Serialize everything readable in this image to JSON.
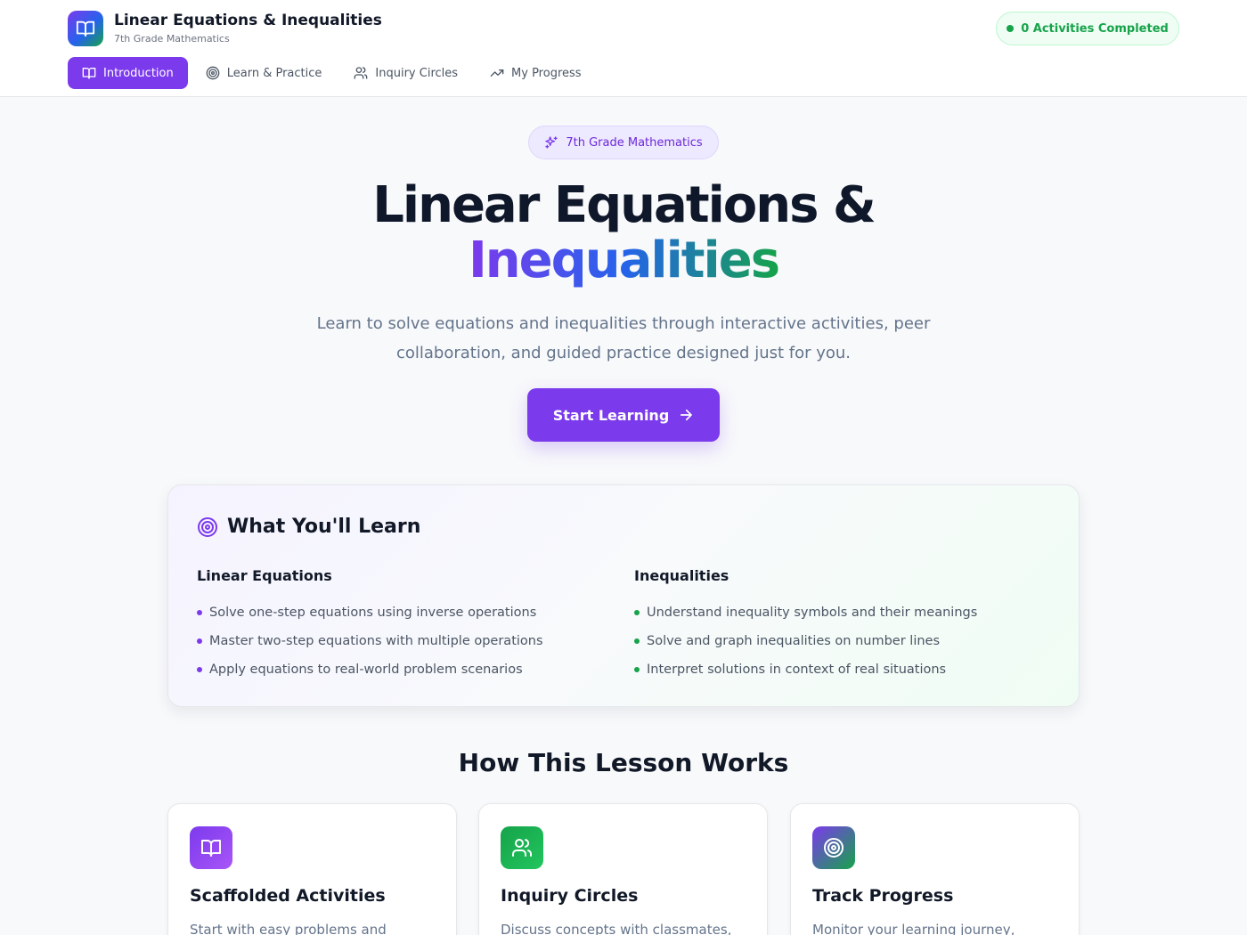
{
  "header": {
    "title": "Linear Equations & Inequalities",
    "subtitle": "7th Grade Mathematics",
    "completed_badge": "0 Activities Completed",
    "logo_icon": "book-open-icon"
  },
  "nav": {
    "items": [
      {
        "label": "Introduction",
        "icon": "book-open-icon",
        "active": true
      },
      {
        "label": "Learn & Practice",
        "icon": "target-icon",
        "active": false
      },
      {
        "label": "Inquiry Circles",
        "icon": "users-icon",
        "active": false
      },
      {
        "label": "My Progress",
        "icon": "trending-up-icon",
        "active": false
      }
    ]
  },
  "hero": {
    "pill": "7th Grade Mathematics",
    "title_line1": "Linear Equations &",
    "title_line2": "Inequalities",
    "description": "Learn to solve equations and inequalities through interactive activities, peer collaboration, and guided practice designed just for you.",
    "cta_label": "Start Learning"
  },
  "learn": {
    "heading": "What You'll Learn",
    "columns": [
      {
        "title": "Linear Equations",
        "items": [
          "Solve one-step equations using inverse operations",
          "Master two-step equations with multiple operations",
          "Apply equations to real-world problem scenarios"
        ]
      },
      {
        "title": "Inequalities",
        "items": [
          "Understand inequality symbols and their meanings",
          "Solve and graph inequalities on number lines",
          "Interpret solutions in context of real situations"
        ]
      }
    ]
  },
  "how": {
    "heading": "How This Lesson Works",
    "features": [
      {
        "title": "Scaffolded Activities",
        "description": "Start with easy problems and",
        "icon": "book-open-icon"
      },
      {
        "title": "Inquiry Circles",
        "description": "Discuss concepts with classmates,",
        "icon": "users-icon"
      },
      {
        "title": "Track Progress",
        "description": "Monitor your learning journey, reflect",
        "icon": "target-icon"
      }
    ]
  },
  "colors": {
    "primary": "#7c3aed",
    "success": "#16a34a",
    "blue": "#2563eb"
  }
}
